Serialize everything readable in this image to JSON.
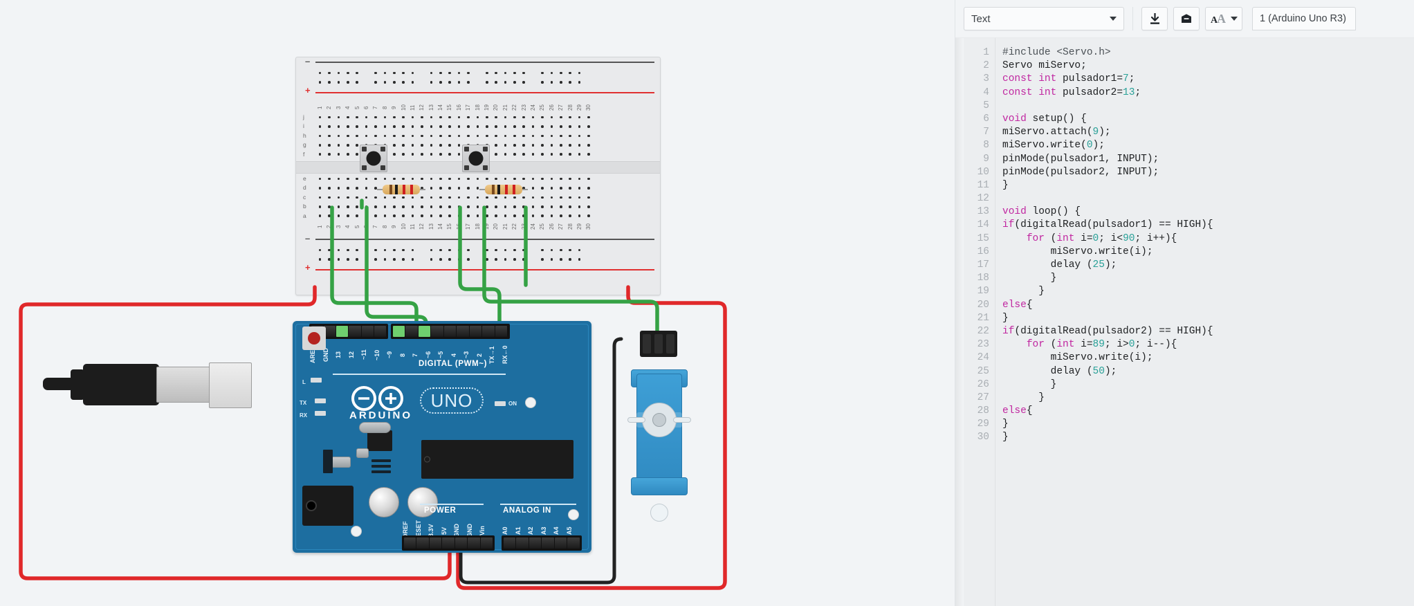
{
  "app": {
    "name": "Tinkercad Circuits"
  },
  "toolbar": {
    "mode_select": {
      "value": "Text",
      "icon": "chevron-down-icon"
    },
    "download_button": {
      "icon": "download-icon",
      "label": "Download Code"
    },
    "library_button": {
      "icon": "library-icon",
      "label": "Libraries"
    },
    "font_size_button": {
      "icon": "font-size-icon",
      "label": "AA"
    },
    "board_tab": {
      "label": "1 (Arduino Uno R3)"
    }
  },
  "editor": {
    "line_numbers": [
      1,
      2,
      3,
      4,
      5,
      6,
      7,
      8,
      9,
      10,
      11,
      12,
      13,
      14,
      15,
      16,
      17,
      18,
      19,
      20,
      21,
      22,
      23,
      24,
      25,
      26,
      27,
      28,
      29,
      30
    ],
    "lines": [
      "#include <Servo.h>",
      "Servo miServo;",
      "const int pulsador1=7;",
      "const int pulsador2=13;",
      "",
      "void setup() {",
      "miServo.attach(9);",
      "miServo.write(0);",
      "pinMode(pulsador1, INPUT);",
      "pinMode(pulsador2, INPUT);",
      "}",
      "",
      "void loop() {",
      "if(digitalRead(pulsador1) == HIGH){",
      "    for (int i=0; i<90; i++){",
      "        miServo.write(i);",
      "        delay (25);",
      "        }",
      "      }",
      "else{",
      "}",
      "if(digitalRead(pulsador2) == HIGH){",
      "    for (int i=89; i>0; i--){",
      "        miServo.write(i);",
      "        delay (50);",
      "        }",
      "      }",
      "else{",
      "}",
      "}"
    ],
    "tokens": [
      [
        [
          "pp",
          "#include <Servo.h>"
        ]
      ],
      [
        [
          "fn",
          "Servo miServo;"
        ]
      ],
      [
        [
          "kw",
          "const int"
        ],
        [
          "fn",
          " pulsador1="
        ],
        [
          "num",
          "7"
        ],
        [
          "fn",
          ";"
        ]
      ],
      [
        [
          "kw",
          "const int"
        ],
        [
          "fn",
          " pulsador2="
        ],
        [
          "num",
          "13"
        ],
        [
          "fn",
          ";"
        ]
      ],
      [],
      [
        [
          "kw",
          "void"
        ],
        [
          "fn",
          " setup() {"
        ]
      ],
      [
        [
          "fn",
          "miServo.attach("
        ],
        [
          "num",
          "9"
        ],
        [
          "fn",
          ");"
        ]
      ],
      [
        [
          "fn",
          "miServo.write("
        ],
        [
          "num",
          "0"
        ],
        [
          "fn",
          ");"
        ]
      ],
      [
        [
          "fn",
          "pinMode(pulsador1, INPUT);"
        ]
      ],
      [
        [
          "fn",
          "pinMode(pulsador2, INPUT);"
        ]
      ],
      [
        [
          "fn",
          "}"
        ]
      ],
      [],
      [
        [
          "kw",
          "void"
        ],
        [
          "fn",
          " loop() {"
        ]
      ],
      [
        [
          "kw",
          "if"
        ],
        [
          "fn",
          "(digitalRead(pulsador1) == HIGH){"
        ]
      ],
      [
        [
          "fn",
          "    "
        ],
        [
          "kw",
          "for"
        ],
        [
          "fn",
          " ("
        ],
        [
          "kw",
          "int"
        ],
        [
          "fn",
          " i="
        ],
        [
          "num",
          "0"
        ],
        [
          "fn",
          "; i<"
        ],
        [
          "num",
          "90"
        ],
        [
          "fn",
          "; i++){"
        ]
      ],
      [
        [
          "fn",
          "        miServo.write(i);"
        ]
      ],
      [
        [
          "fn",
          "        delay ("
        ],
        [
          "num",
          "25"
        ],
        [
          "fn",
          ");"
        ]
      ],
      [
        [
          "fn",
          "        }"
        ]
      ],
      [
        [
          "fn",
          "      }"
        ]
      ],
      [
        [
          "kw",
          "else"
        ],
        [
          "fn",
          "{"
        ]
      ],
      [
        [
          "fn",
          "}"
        ]
      ],
      [
        [
          "kw",
          "if"
        ],
        [
          "fn",
          "(digitalRead(pulsador2) == HIGH){"
        ]
      ],
      [
        [
          "fn",
          "    "
        ],
        [
          "kw",
          "for"
        ],
        [
          "fn",
          " ("
        ],
        [
          "kw",
          "int"
        ],
        [
          "fn",
          " i="
        ],
        [
          "num",
          "89"
        ],
        [
          "fn",
          "; i>"
        ],
        [
          "num",
          "0"
        ],
        [
          "fn",
          "; i--){"
        ]
      ],
      [
        [
          "fn",
          "        miServo.write(i);"
        ]
      ],
      [
        [
          "fn",
          "        delay ("
        ],
        [
          "num",
          "50"
        ],
        [
          "fn",
          ");"
        ]
      ],
      [
        [
          "fn",
          "        }"
        ]
      ],
      [
        [
          "fn",
          "      }"
        ]
      ],
      [
        [
          "kw",
          "else"
        ],
        [
          "fn",
          "{"
        ]
      ],
      [
        [
          "fn",
          "}"
        ]
      ],
      [
        [
          "fn",
          "}"
        ]
      ]
    ]
  },
  "circuit": {
    "breadboard": {
      "name": "Breadboard Small",
      "row_letters_top": [
        "j",
        "i",
        "h",
        "g",
        "f"
      ],
      "row_letters_bottom": [
        "e",
        "d",
        "c",
        "b",
        "a"
      ],
      "column_numbers": [
        1,
        2,
        3,
        4,
        5,
        6,
        7,
        8,
        9,
        10,
        11,
        12,
        13,
        14,
        15,
        16,
        17,
        18,
        19,
        20,
        21,
        22,
        23,
        24,
        25,
        26,
        27,
        28,
        29,
        30
      ],
      "rail_signs": {
        "negative": "–",
        "positive": "+"
      }
    },
    "arduino": {
      "board_name": "Arduino Uno R3",
      "brand": "ARDUINO",
      "model_badge": "UNO",
      "power_led_label": "ON",
      "leds": [
        "L",
        "TX",
        "RX"
      ],
      "digital_header_label": "DIGITAL (PWM~)",
      "digital_pins": [
        "AREF",
        "GND",
        "13",
        "12",
        "~11",
        "~10",
        "~9",
        "8",
        "7",
        "~6",
        "~5",
        "4",
        "~3",
        "2",
        "TX→1",
        "RX←0"
      ],
      "power_header_label": "POWER",
      "power_pins": [
        "IOREF",
        "RESET",
        "3.3V",
        "5V",
        "GND",
        "GND",
        "Vin"
      ],
      "analog_header_label": "ANALOG IN",
      "analog_pins": [
        "A0",
        "A1",
        "A2",
        "A3",
        "A4",
        "A5"
      ]
    },
    "components": [
      {
        "name": "pushbutton-1",
        "type": "pushbutton"
      },
      {
        "name": "pushbutton-2",
        "type": "pushbutton"
      },
      {
        "name": "resistor-1",
        "type": "resistor"
      },
      {
        "name": "resistor-2",
        "type": "resistor"
      },
      {
        "name": "micro-servo",
        "type": "servo"
      },
      {
        "name": "usb-cable",
        "type": "usb-cable"
      }
    ],
    "colors": {
      "wire_power": "#e0282a",
      "wire_signal": "#35a245",
      "wire_ground": "#222222",
      "pcb": "#1d6ea0",
      "breadboard": "#e9eaec",
      "servo": "#3e9fd6"
    }
  }
}
